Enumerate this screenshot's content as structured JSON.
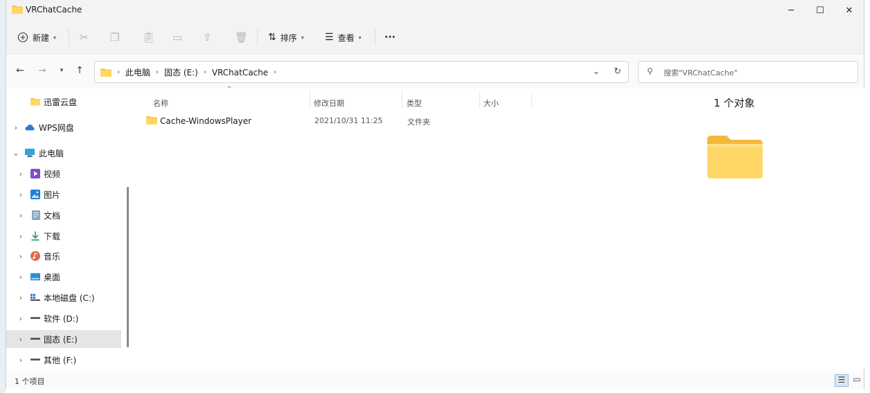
{
  "window": {
    "title": "VRChatCache"
  },
  "toolbar": {
    "new_label": "新建",
    "sort_label": "排序",
    "view_label": "查看",
    "more_label": "···"
  },
  "address": {
    "segments": [
      "此电脑",
      "固态 (E:)",
      "VRChatCache"
    ]
  },
  "search": {
    "placeholder": "搜索\"VRChatCache\""
  },
  "sidebar": {
    "items": [
      {
        "label": "迅雷云盘",
        "icon": "folder-icon"
      },
      {
        "label": "WPS网盘",
        "icon": "cloud-icon"
      },
      {
        "label": "此电脑",
        "icon": "computer-icon"
      },
      {
        "label": "视频",
        "icon": "video-icon"
      },
      {
        "label": "图片",
        "icon": "picture-icon"
      },
      {
        "label": "文档",
        "icon": "document-icon"
      },
      {
        "label": "下载",
        "icon": "download-icon"
      },
      {
        "label": "音乐",
        "icon": "music-icon"
      },
      {
        "label": "桌面",
        "icon": "desktop-icon"
      },
      {
        "label": "本地磁盘 (C:)",
        "icon": "drive-icon"
      },
      {
        "label": "软件 (D:)",
        "icon": "drive-icon"
      },
      {
        "label": "固态 (E:)",
        "icon": "drive-icon"
      },
      {
        "label": "其他 (F:)",
        "icon": "drive-icon"
      }
    ]
  },
  "columns": [
    "名称",
    "修改日期",
    "类型",
    "大小"
  ],
  "files": [
    {
      "name": "Cache-WindowsPlayer",
      "date": "2021/10/31 11:25",
      "type": "文件夹",
      "size": ""
    }
  ],
  "details": {
    "title": "1 个对象"
  },
  "status": {
    "count": "1 个项目"
  },
  "colors": {
    "accent": "#0067c0",
    "folder": "#f8c94a",
    "selection": "#e5e5e5"
  }
}
